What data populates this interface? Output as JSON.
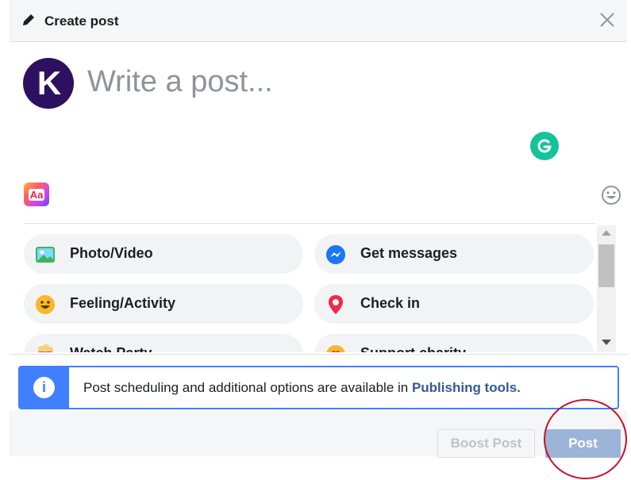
{
  "dialog": {
    "title": "Create post",
    "close_icon": "close-icon",
    "header_icon": "pencil-icon"
  },
  "composer": {
    "avatar_letter": "K",
    "placeholder": "Write a post...",
    "avatar_color": "#2d1060"
  },
  "tools": {
    "text_style_icon": "text-background-icon",
    "text_style_label": "Aa",
    "emoji_icon": "smiley-icon",
    "grammarly_icon": "grammarly-icon"
  },
  "actions": [
    {
      "label": "Photo/Video",
      "icon": "photo-video-icon"
    },
    {
      "label": "Get messages",
      "icon": "messenger-icon"
    },
    {
      "label": "Feeling/Activity",
      "icon": "feeling-emoji-icon"
    },
    {
      "label": "Check in",
      "icon": "location-pin-icon"
    },
    {
      "label": "Watch Party",
      "icon": "popcorn-icon"
    },
    {
      "label": "Support charity",
      "icon": "heart-icon"
    }
  ],
  "notice": {
    "text": "Post scheduling and additional options are available in ",
    "link": "Publishing tools.",
    "accent": "#4080ff"
  },
  "footer": {
    "boost_label": "Boost Post",
    "post_label": "Post"
  }
}
